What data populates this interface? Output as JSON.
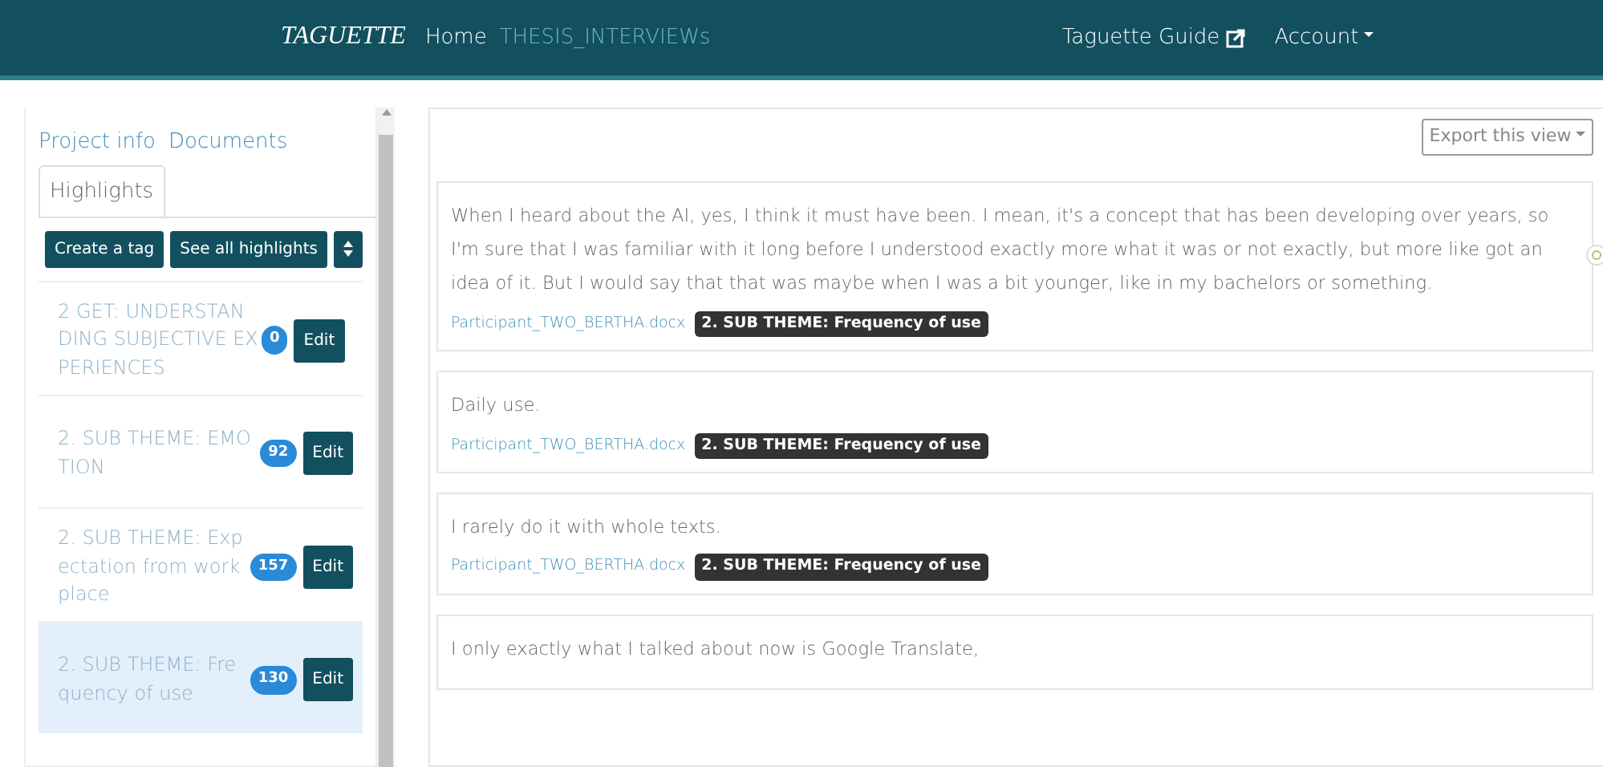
{
  "navbar": {
    "brand": "TAGUETTE",
    "links": [
      {
        "label": "Home",
        "kind": "home"
      },
      {
        "label": "THESIS_INTERVIEWs",
        "kind": "project"
      }
    ],
    "guide": "Taguette Guide",
    "account": "Account"
  },
  "sidebar": {
    "tabs": [
      {
        "label": "Project info",
        "selected": false
      },
      {
        "label": "Documents",
        "selected": false
      },
      {
        "label": "Highlights",
        "selected": true
      }
    ],
    "buttons": [
      "Create a tag",
      "See all highlights"
    ],
    "tags": [
      {
        "name": "2 GET: UNDERSTANDING SUBJECTIVE EXPERIENCES",
        "count": "0",
        "selected": false,
        "edit_label": "Edit"
      },
      {
        "name": "2. SUB THEME: EMOTION",
        "count": "92",
        "selected": false,
        "edit_label": "Edit"
      },
      {
        "name": "2. SUB THEME: Expectation from workplace",
        "count": "157",
        "selected": false,
        "edit_label": "Edit"
      },
      {
        "name": "2. SUB THEME: Frequency of use",
        "count": "130",
        "selected": true,
        "edit_label": "Edit"
      }
    ]
  },
  "main": {
    "export": "Export this view",
    "highlights": [
      {
        "text": "When I heard about the AI, yes, I think it must have been. I mean, it's a concept that has been developing over years, so I'm sure that I was familiar with it long before I understood exactly more what it was or not exactly, but more like got an idea of it. But I would say that that was maybe when I was a bit younger, like in my bachelors or something.",
        "document": "Participant_TWO_BERTHA.docx",
        "tag": "2. SUB THEME: Frequency of use"
      },
      {
        "text": "Daily use.",
        "document": "Participant_TWO_BERTHA.docx",
        "tag": "2. SUB THEME: Frequency of use"
      },
      {
        "text": "I rarely do it with whole texts.",
        "document": "Participant_TWO_BERTHA.docx",
        "tag": "2. SUB THEME: Frequency of use"
      },
      {
        "text": "I only exactly what I talked about now is Google Translate,"
      }
    ]
  }
}
